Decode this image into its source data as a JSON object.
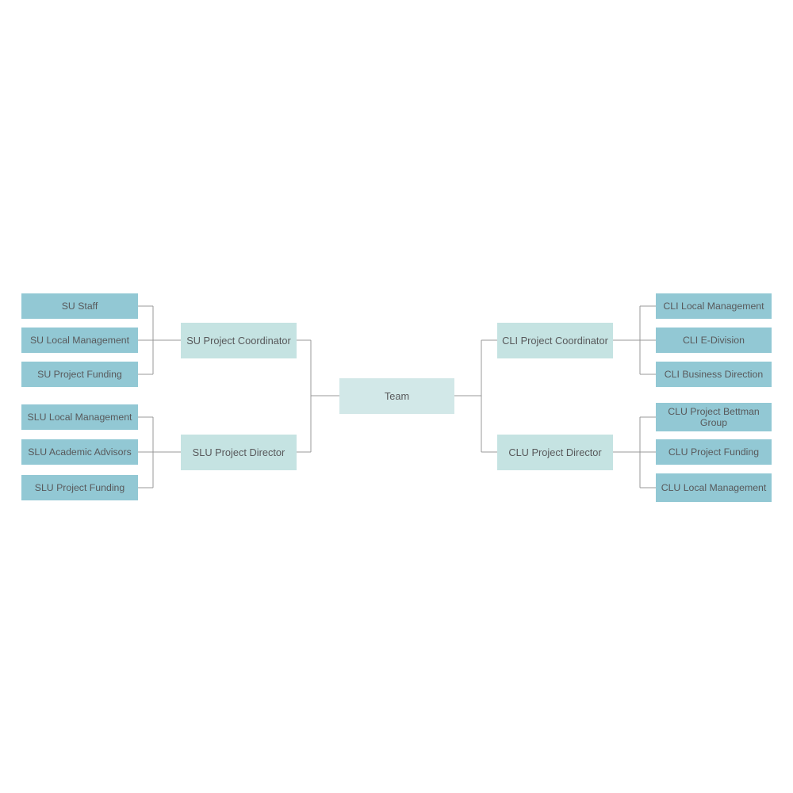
{
  "diagram": {
    "type": "org-chart",
    "orientation": "horizontal-bidirectional",
    "colors": {
      "leaf_fill": "#92c8d4",
      "branch_fill": "#c5e3e2",
      "root_fill": "#d2e8e8",
      "connector": "#999999",
      "text": "#58595b",
      "background": "#ffffff"
    },
    "root": {
      "label": "Team"
    },
    "branches": [
      {
        "id": "su",
        "side": "left",
        "label": "SU Project Coordinator",
        "children": [
          {
            "label": "SU Staff"
          },
          {
            "label": "SU Local Management"
          },
          {
            "label": "SU Project Funding"
          }
        ]
      },
      {
        "id": "slu",
        "side": "left",
        "label": "SLU Project Director",
        "children": [
          {
            "label": "SLU Local Management"
          },
          {
            "label": "SLU Academic Advisors"
          },
          {
            "label": "SLU Project Funding"
          }
        ]
      },
      {
        "id": "cli",
        "side": "right",
        "label": "CLI Project Coordinator",
        "children": [
          {
            "label": "CLI Local Management"
          },
          {
            "label": "CLI E-Division"
          },
          {
            "label": "CLI Business Direction"
          }
        ]
      },
      {
        "id": "clu",
        "side": "right",
        "label": "CLU Project Director",
        "children": [
          {
            "label": "CLU Project Bettman Group"
          },
          {
            "label": "CLU Project Funding"
          },
          {
            "label": "CLU Local Management"
          }
        ]
      }
    ]
  }
}
